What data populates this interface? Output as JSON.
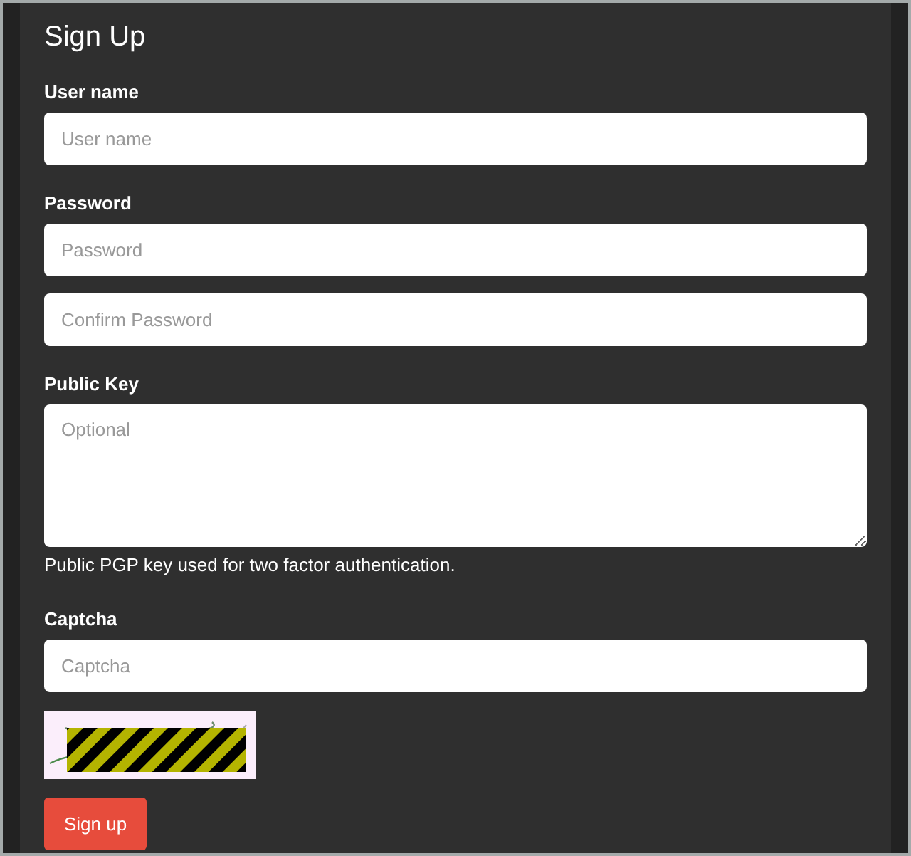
{
  "title": "Sign Up",
  "username": {
    "label": "User name",
    "placeholder": "User name"
  },
  "password": {
    "label": "Password",
    "placeholder": "Password",
    "confirm_placeholder": "Confirm Password"
  },
  "public_key": {
    "label": "Public Key",
    "placeholder": "Optional",
    "help": "Public PGP key used for two factor authentication."
  },
  "captcha": {
    "label": "Captcha",
    "placeholder": "Captcha"
  },
  "submit": "Sign up"
}
